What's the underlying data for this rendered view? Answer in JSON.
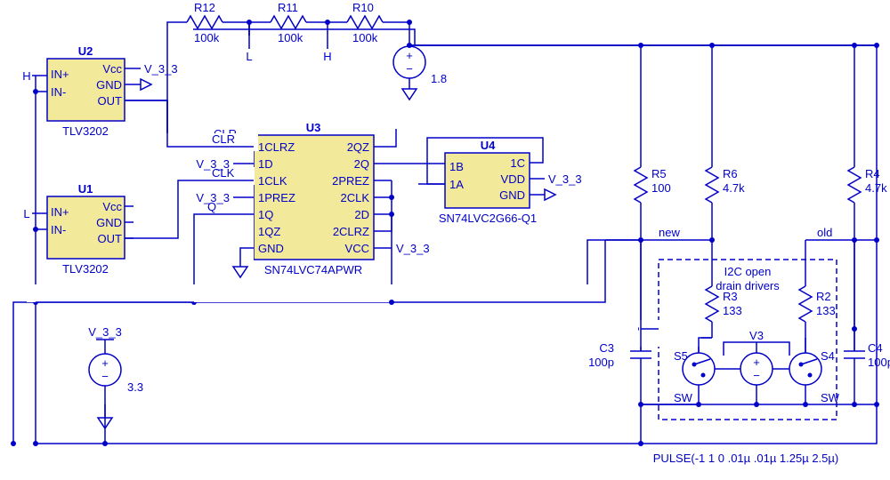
{
  "components": {
    "U1": {
      "ref": "U1",
      "type": "TLV3202",
      "pins": {
        "p1": "IN+",
        "p2": "IN-",
        "p3": "Vcc",
        "p4": "GND",
        "p5": "OUT"
      }
    },
    "U2": {
      "ref": "U2",
      "type": "TLV3202",
      "pins": {
        "p1": "IN+",
        "p2": "IN-",
        "p3": "Vcc",
        "p4": "GND",
        "p5": "OUT"
      }
    },
    "U3": {
      "ref": "U3",
      "type": "SN74LVC74APWR",
      "pins_left": {
        "p1": "1CLRZ",
        "p2": "1D",
        "p3": "1CLK",
        "p4": "1PREZ",
        "p5": "1Q",
        "p6": "1QZ",
        "p7": "GND"
      },
      "pins_right": {
        "p1": "2QZ",
        "p2": "2Q",
        "p3": "2PREZ",
        "p4": "2CLK",
        "p5": "2D",
        "p6": "2CLRZ",
        "p7": "VCC"
      }
    },
    "U4": {
      "ref": "U4",
      "type": "SN74LVC2G66-Q1",
      "pins_left": {
        "p1": "1B",
        "p2": "1A"
      },
      "pins_right": {
        "p1": "1C",
        "p2": "VDD",
        "p3": "GND"
      }
    },
    "R2": {
      "ref": "R2",
      "value": "133"
    },
    "R3": {
      "ref": "R3",
      "value": "133"
    },
    "R4": {
      "ref": "R4",
      "value": "4.7k"
    },
    "R5": {
      "ref": "R5",
      "value": "100"
    },
    "R6": {
      "ref": "R6",
      "value": "4.7k"
    },
    "R10": {
      "ref": "R10",
      "value": "100k"
    },
    "R11": {
      "ref": "R11",
      "value": "100k"
    },
    "R12": {
      "ref": "R12",
      "value": "100k"
    },
    "C3": {
      "ref": "C3",
      "value": "100p"
    },
    "C4": {
      "ref": "C4",
      "value": "100p"
    },
    "V1": {
      "value": "3.3"
    },
    "V2": {
      "value": "1.8"
    },
    "V3": {
      "ref": "V3"
    },
    "S4": {
      "ref": "S4",
      "value": "SW"
    },
    "S5": {
      "ref": "S5",
      "value": "SW"
    }
  },
  "nets": {
    "H": "H",
    "L": "L",
    "V33": "V_3_3",
    "CLR": "CLR",
    "CLK": "CLK",
    "Q": "Q",
    "new": "new",
    "old": "old"
  },
  "annotations": {
    "i2c_box": "I2C open\ndrain drivers",
    "pulse": "PULSE(-1 1 0 .01µ .01µ 1.25µ 2.5µ)"
  }
}
